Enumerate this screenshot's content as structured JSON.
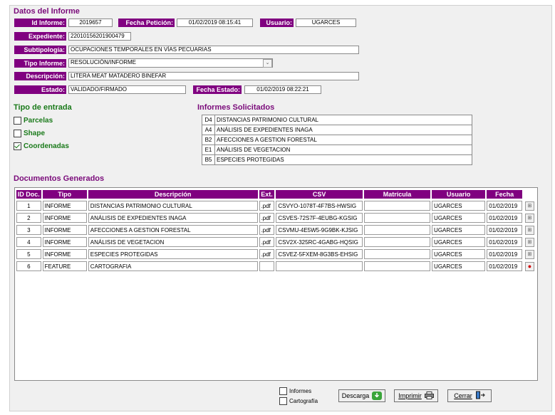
{
  "datos": {
    "title": "Datos del Informe",
    "id_informe_label": "Id Informe:",
    "id_informe_value": "2019657",
    "fecha_peticion_label": "Fecha Petición:",
    "fecha_peticion_value": "01/02/2019 08:15:41",
    "usuario_label": "Usuario:",
    "usuario_value": "UGARCES",
    "expediente_label": "Expediente:",
    "expediente_value": "22010156201900479",
    "subtipologia_label": "Subtipología:",
    "subtipologia_value": "OCUPACIONES TEMPORALES EN VÍAS PECUARIAS",
    "tipo_informe_label": "Tipo Informe:",
    "tipo_informe_value": "RESOLUCIÓN/INFORME",
    "descripcion_label": "Descripción:",
    "descripcion_value": "LITERA MEAT MATADERO BINEFAR",
    "estado_label": "Estado:",
    "estado_value": "VALIDADO/FIRMADO",
    "fecha_estado_label": "Fecha Estado:",
    "fecha_estado_value": "01/02/2019 08:22:21"
  },
  "tipo_entrada": {
    "title": "Tipo de entrada",
    "options": [
      {
        "label": "Parcelas",
        "checked": false
      },
      {
        "label": "Shape",
        "checked": false
      },
      {
        "label": "Coordenadas",
        "checked": true
      }
    ]
  },
  "informes_solicitados": {
    "title": "Informes Solicitados",
    "items": [
      {
        "code": "D4",
        "name": "DISTANCIAS PATRIMONIO CULTURAL"
      },
      {
        "code": "A4",
        "name": "ANÁLISIS DE EXPEDIENTES INAGA"
      },
      {
        "code": "B2",
        "name": "AFECCIONES A GESTION FORESTAL"
      },
      {
        "code": "E1",
        "name": "ANÁLISIS DE VEGETACION"
      },
      {
        "code": "B5",
        "name": "ESPECIES PROTEGIDAS"
      }
    ]
  },
  "documentos": {
    "title": "Documentos Generados",
    "columns": [
      "ID Doc.",
      "Tipo",
      "Descripción",
      "Ext.",
      "CSV",
      "Matrícula",
      "Usuario",
      "Fecha"
    ],
    "rows": [
      {
        "id": "1",
        "tipo": "INFORME",
        "descripcion": "DISTANCIAS PATRIMONIO CULTURAL",
        "ext": ".pdf",
        "csv": "CSVYO-1078T-4F7BS-HWSIG",
        "matricula": "",
        "usuario": "UGARCES",
        "fecha": "01/02/2019",
        "icon": "document-view-icon"
      },
      {
        "id": "2",
        "tipo": "INFORME",
        "descripcion": "ANÁLISIS DE EXPEDIENTES INAGA",
        "ext": ".pdf",
        "csv": "CSVES-72S7F-4EUBG-KGSIG",
        "matricula": "",
        "usuario": "UGARCES",
        "fecha": "01/02/2019",
        "icon": "document-view-icon"
      },
      {
        "id": "3",
        "tipo": "INFORME",
        "descripcion": "AFECCIONES A GESTION FORESTAL",
        "ext": ".pdf",
        "csv": "CSVMU-4E5W5-9G9BK-KJSIG",
        "matricula": "",
        "usuario": "UGARCES",
        "fecha": "01/02/2019",
        "icon": "document-view-icon"
      },
      {
        "id": "4",
        "tipo": "INFORME",
        "descripcion": "ANÁLISIS DE VEGETACION",
        "ext": ".pdf",
        "csv": "CSV2X-325RC-4GABG-HQSIG",
        "matricula": "",
        "usuario": "UGARCES",
        "fecha": "01/02/2019",
        "icon": "document-view-icon"
      },
      {
        "id": "5",
        "tipo": "INFORME",
        "descripcion": "ESPECIES PROTEGIDAS",
        "ext": ".pdf",
        "csv": "CSVEZ-5FXEM-8G3BS-EHSIG",
        "matricula": "",
        "usuario": "UGARCES",
        "fecha": "01/02/2019",
        "icon": "document-view-icon"
      },
      {
        "id": "6",
        "tipo": "FEATURE",
        "descripcion": "CARTOGRAFIA",
        "ext": "",
        "csv": "",
        "matricula": "",
        "usuario": "UGARCES",
        "fecha": "01/02/2019",
        "icon": "map-marker-icon"
      }
    ]
  },
  "footer": {
    "informes_label": "Informes",
    "cartografia_label": "Cartografía",
    "descarga_label": "Descarga",
    "imprimir_label": "Imprimir",
    "cerrar_label": "Cerrar"
  },
  "colors": {
    "label_bg": "#800080",
    "section_purple": "#7a0a7a",
    "section_green": "#1a7a1a"
  }
}
